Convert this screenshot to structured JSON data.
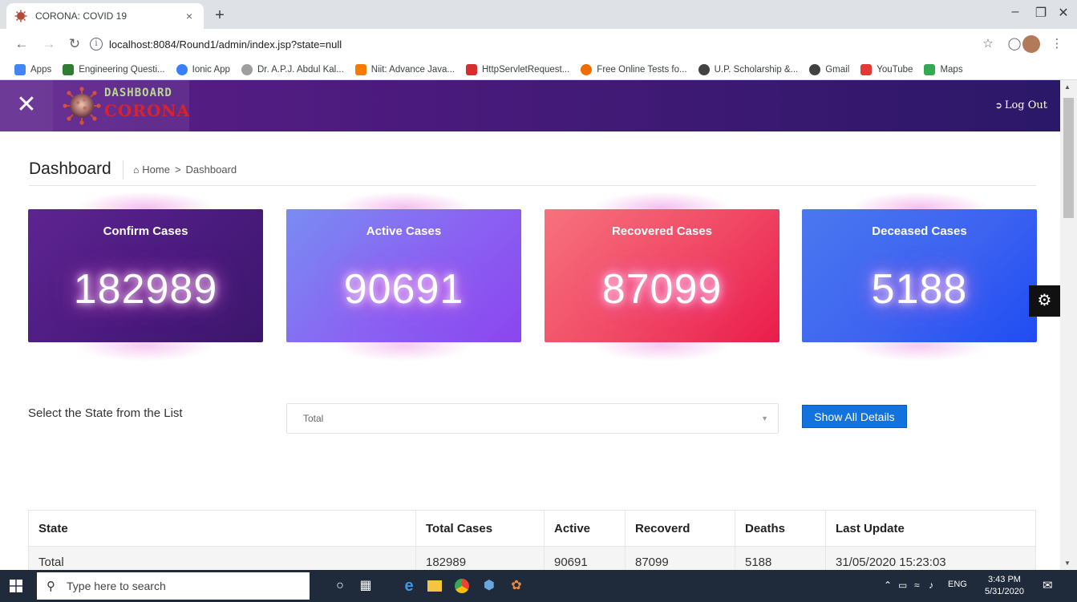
{
  "browser": {
    "tab_title": "CORONA: COVID 19",
    "tab_close": "×",
    "new_tab": "+",
    "url": "localhost:8084/Round1/admin/index.jsp?state=null",
    "bookmarks": [
      {
        "label": "Apps",
        "color": "#4285f4"
      },
      {
        "label": "Engineering Questi...",
        "color": "#2e7d32"
      },
      {
        "label": "Ionic App",
        "color": "#3880ff"
      },
      {
        "label": "Dr. A.P.J. Abdul Kal...",
        "color": "#9e9e9e"
      },
      {
        "label": "Niit: Advance Java...",
        "color": "#f57c00"
      },
      {
        "label": "HttpServletRequest...",
        "color": "#d32f2f"
      },
      {
        "label": "Free Online Tests fo...",
        "color": "#ef6c00"
      },
      {
        "label": "U.P. Scholarship &...",
        "color": "#424242"
      },
      {
        "label": "Gmail",
        "color": "#424242"
      },
      {
        "label": "YouTube",
        "color": "#e53935"
      },
      {
        "label": "Maps",
        "color": "#34a853"
      }
    ]
  },
  "header": {
    "brand_top": "DASHBOARD",
    "brand_bottom": "CORONA",
    "logout_label": "Log Out"
  },
  "page": {
    "title": "Dashboard",
    "breadcrumb_home": "Home",
    "breadcrumb_sep": ">",
    "breadcrumb_current": "Dashboard"
  },
  "cards": [
    {
      "title": "Confirm Cases",
      "value": "182989"
    },
    {
      "title": "Active Cases",
      "value": "90691"
    },
    {
      "title": "Recovered Cases",
      "value": "87099"
    },
    {
      "title": "Deceased Cases",
      "value": "5188"
    }
  ],
  "filter": {
    "label": "Select the State from the List",
    "selected": "Total",
    "button_label": "Show All Details"
  },
  "table": {
    "headers": [
      "State",
      "Total Cases",
      "Active",
      "Recoverd",
      "Deaths",
      "Last Update"
    ],
    "rows": [
      [
        "Total",
        "182989",
        "90691",
        "87099",
        "5188",
        "31/05/2020 15:23:03"
      ]
    ]
  },
  "taskbar": {
    "search_placeholder": "Type here to search",
    "lang": "ENG",
    "time": "3:43 PM",
    "date": "5/31/2020"
  }
}
